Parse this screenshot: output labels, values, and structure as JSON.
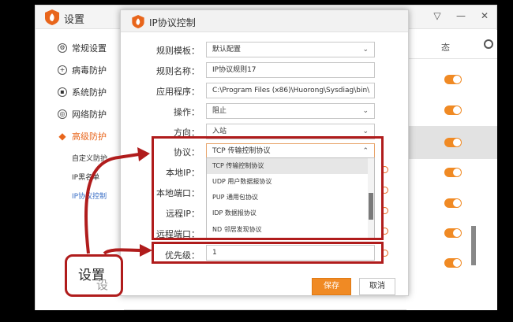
{
  "main_window": {
    "title": "设置",
    "controls": [
      "▽",
      "—",
      "✕"
    ],
    "tab_partial": "态",
    "sidebar": [
      {
        "icon": "gear-icon",
        "glyph": "⚙",
        "label": "常规设置"
      },
      {
        "icon": "virus-shield-icon",
        "glyph": "+",
        "label": "病毒防护"
      },
      {
        "icon": "system-shield-icon",
        "glyph": "▪",
        "label": "系统防护"
      },
      {
        "icon": "globe-icon",
        "glyph": "◎",
        "label": "网络防护"
      },
      {
        "icon": "diamond-icon",
        "glyph": "◆",
        "label": "高级防护"
      }
    ],
    "subitems": [
      "自定义防护",
      "IP黑名单",
      "IP协议控制"
    ]
  },
  "dialog": {
    "title": "IP协议控制",
    "fields": {
      "template": {
        "label": "规则模板：",
        "value": "默认配置"
      },
      "name": {
        "label": "规则名称：",
        "value": "IP协议规则17"
      },
      "app": {
        "label": "应用程序：",
        "value": "C:\\Program Files (x86)\\Huorong\\Sysdiag\\bin\\"
      },
      "action": {
        "label": "操作：",
        "value": "阻止"
      },
      "direction": {
        "label": "方向：",
        "value": "入站"
      },
      "protocol": {
        "label": "协议：",
        "value": "TCP 传输控制协议"
      },
      "local_ip": {
        "label": "本地IP："
      },
      "local_port": {
        "label": "本地端口："
      },
      "remote_ip": {
        "label": "远程IP："
      },
      "remote_port": {
        "label": "远程端口："
      },
      "priority": {
        "label": "优先级：",
        "value": "1"
      }
    },
    "protocol_options": [
      "TCP 传输控制协议",
      "UDP 用户数据报协议",
      "PUP 通用包协议",
      "IDP 数据报协议",
      "ND 邻居发现协议"
    ],
    "buttons": {
      "save": "保存",
      "cancel": "取消"
    }
  },
  "annotation": {
    "callout": "设置",
    "ghost": "设",
    "color": "#b01c1c"
  },
  "colors": {
    "accent": "#f08a24",
    "link": "#3b6fc6"
  }
}
